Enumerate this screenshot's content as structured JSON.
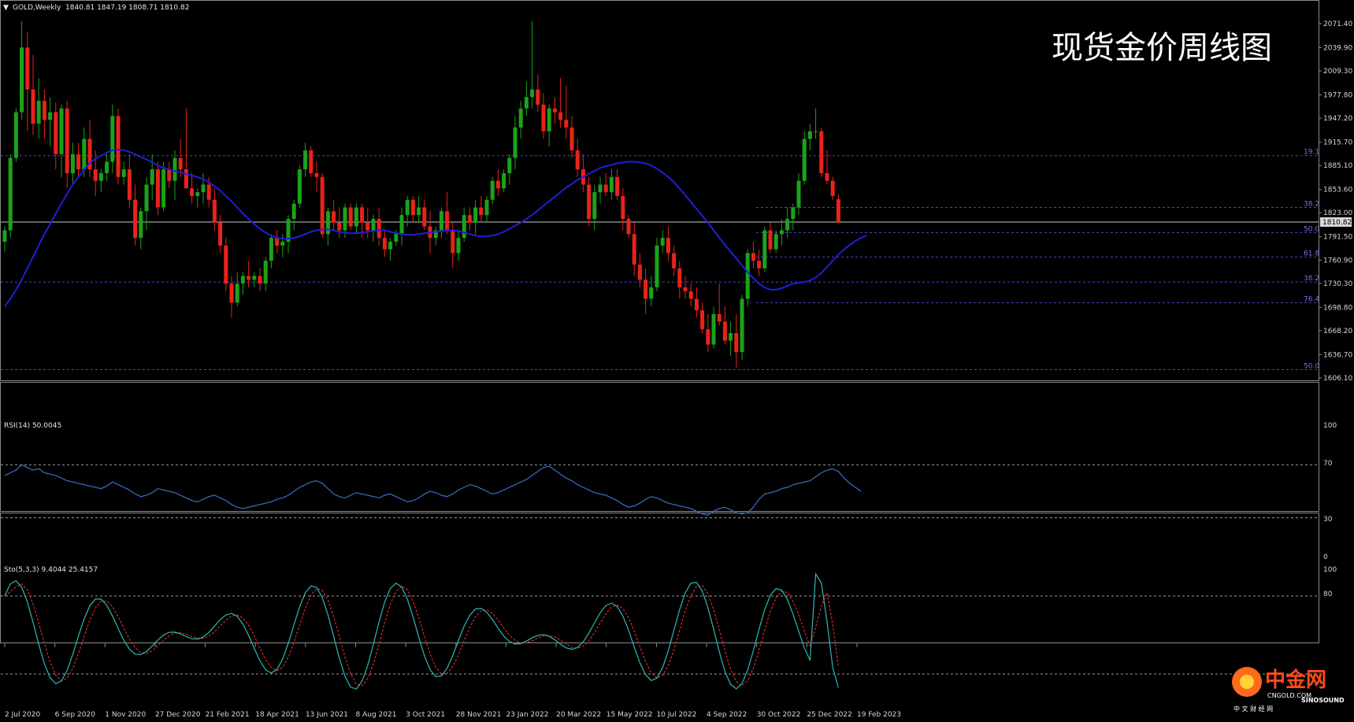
{
  "header": {
    "symbol": "GOLD,Weekly",
    "ohlc": "1840.81 1847.19 1808.71 1810.82",
    "overlay_title": "现货金价周线图"
  },
  "price_labels": [
    "2071.40",
    "2039.90",
    "2009.30",
    "1977.80",
    "1947.20",
    "1915.70",
    "1885.10",
    "1853.60",
    "1823.00",
    "1791.50",
    "1760.90",
    "1730.30",
    "1698.80",
    "1668.20",
    "1636.70",
    "1606.10"
  ],
  "current_price_label": "1810.82",
  "x_labels": [
    "2 Jul 2020",
    "6 Sep 2020",
    "1 Nov 2020",
    "27 Dec 2020",
    "21 Feb 2021",
    "18 Apr 2021",
    "13 Jun 2021",
    "8 Aug 2021",
    "3 Oct 2021",
    "28 Nov 2021",
    "23 Jan 2022",
    "20 Mar 2022",
    "15 May 2022",
    "10 Jul 2022",
    "4 Sep 2022",
    "30 Oct 2022",
    "25 Dec 2022",
    "19 Feb 2023"
  ],
  "fib_labels": [
    "19.1",
    "38.2",
    "50.0",
    "61.8",
    "38.2",
    "76.4",
    "50.0"
  ],
  "rsi": {
    "label": "RSI(14) 50.0045",
    "levels": [
      "100",
      "70",
      "30",
      "0"
    ]
  },
  "stoch": {
    "label": "Sto(5,3,3) 9.4044 25.4157",
    "levels": [
      "100",
      "80"
    ]
  },
  "logo": {
    "brand": "中金网",
    "url": "CNGOLD.COM",
    "slogan": "中 文 财 经 网",
    "partner": "SINOSOUND"
  },
  "colors": {
    "background": "#000000",
    "bull": "#1aa31a",
    "bear": "#e8231a",
    "ma": "#1f1fd6",
    "rsi": "#3a6fc8",
    "stoch_main": "#2fb7b7",
    "stoch_signal": "#d42a2a",
    "grid_dash": "#8888a8",
    "fib": "#4a45c8",
    "price_line": "#c8c8c8"
  },
  "chart_data": {
    "type": "candlestick",
    "title": "现货金价周线图",
    "ylim": [
      1606.1,
      2083.0
    ],
    "current_price": 1810.82,
    "candles": [
      [
        1785,
        1805,
        1772,
        1800
      ],
      [
        1800,
        1900,
        1790,
        1895
      ],
      [
        1895,
        1960,
        1890,
        1955
      ],
      [
        1955,
        2075,
        1945,
        2040
      ],
      [
        2040,
        2060,
        1930,
        1985
      ],
      [
        1985,
        2030,
        1925,
        1940
      ],
      [
        1940,
        2000,
        1920,
        1970
      ],
      [
        1970,
        1985,
        1920,
        1945
      ],
      [
        1945,
        1975,
        1910,
        1955
      ],
      [
        1955,
        1968,
        1880,
        1900
      ],
      [
        1900,
        1965,
        1870,
        1960
      ],
      [
        1960,
        1970,
        1855,
        1875
      ],
      [
        1875,
        1915,
        1860,
        1900
      ],
      [
        1900,
        1915,
        1870,
        1880
      ],
      [
        1880,
        1935,
        1870,
        1920
      ],
      [
        1920,
        1945,
        1870,
        1880
      ],
      [
        1880,
        1905,
        1845,
        1865
      ],
      [
        1865,
        1880,
        1850,
        1875
      ],
      [
        1875,
        1900,
        1865,
        1890
      ],
      [
        1890,
        1965,
        1875,
        1950
      ],
      [
        1950,
        1960,
        1860,
        1870
      ],
      [
        1870,
        1890,
        1860,
        1880
      ],
      [
        1880,
        1900,
        1830,
        1840
      ],
      [
        1840,
        1860,
        1780,
        1790
      ],
      [
        1790,
        1830,
        1775,
        1825
      ],
      [
        1825,
        1870,
        1800,
        1860
      ],
      [
        1860,
        1900,
        1840,
        1880
      ],
      [
        1880,
        1890,
        1820,
        1830
      ],
      [
        1830,
        1890,
        1825,
        1880
      ],
      [
        1880,
        1890,
        1855,
        1865
      ],
      [
        1865,
        1905,
        1840,
        1895
      ],
      [
        1895,
        1920,
        1870,
        1880
      ],
      [
        1880,
        1960,
        1860,
        1855
      ],
      [
        1855,
        1875,
        1835,
        1845
      ],
      [
        1845,
        1855,
        1830,
        1850
      ],
      [
        1850,
        1875,
        1835,
        1860
      ],
      [
        1860,
        1870,
        1830,
        1840
      ],
      [
        1840,
        1855,
        1800,
        1810
      ],
      [
        1810,
        1820,
        1770,
        1780
      ],
      [
        1780,
        1790,
        1720,
        1730
      ],
      [
        1730,
        1740,
        1685,
        1705
      ],
      [
        1705,
        1745,
        1700,
        1730
      ],
      [
        1730,
        1745,
        1715,
        1740
      ],
      [
        1740,
        1760,
        1725,
        1735
      ],
      [
        1735,
        1745,
        1725,
        1740
      ],
      [
        1740,
        1750,
        1720,
        1730
      ],
      [
        1730,
        1765,
        1720,
        1760
      ],
      [
        1760,
        1795,
        1750,
        1790
      ],
      [
        1790,
        1800,
        1770,
        1780
      ],
      [
        1780,
        1795,
        1765,
        1785
      ],
      [
        1785,
        1820,
        1770,
        1815
      ],
      [
        1815,
        1840,
        1800,
        1835
      ],
      [
        1835,
        1885,
        1830,
        1880
      ],
      [
        1880,
        1915,
        1870,
        1905
      ],
      [
        1905,
        1910,
        1870,
        1875
      ],
      [
        1875,
        1890,
        1850,
        1870
      ],
      [
        1870,
        1875,
        1790,
        1795
      ],
      [
        1795,
        1830,
        1780,
        1825
      ],
      [
        1825,
        1840,
        1800,
        1810
      ],
      [
        1810,
        1830,
        1790,
        1800
      ],
      [
        1800,
        1835,
        1790,
        1830
      ],
      [
        1830,
        1835,
        1800,
        1805
      ],
      [
        1805,
        1835,
        1795,
        1830
      ],
      [
        1830,
        1835,
        1790,
        1810
      ],
      [
        1810,
        1830,
        1790,
        1800
      ],
      [
        1800,
        1820,
        1785,
        1815
      ],
      [
        1815,
        1830,
        1780,
        1790
      ],
      [
        1790,
        1800,
        1765,
        1775
      ],
      [
        1775,
        1790,
        1760,
        1785
      ],
      [
        1785,
        1800,
        1780,
        1795
      ],
      [
        1795,
        1830,
        1780,
        1820
      ],
      [
        1820,
        1845,
        1805,
        1840
      ],
      [
        1840,
        1845,
        1810,
        1820
      ],
      [
        1820,
        1845,
        1810,
        1830
      ],
      [
        1830,
        1840,
        1800,
        1805
      ],
      [
        1805,
        1825,
        1770,
        1790
      ],
      [
        1790,
        1805,
        1780,
        1800
      ],
      [
        1800,
        1830,
        1790,
        1825
      ],
      [
        1825,
        1850,
        1795,
        1800
      ],
      [
        1800,
        1810,
        1750,
        1770
      ],
      [
        1770,
        1800,
        1760,
        1790
      ],
      [
        1790,
        1830,
        1785,
        1820
      ],
      [
        1820,
        1830,
        1800,
        1810
      ],
      [
        1810,
        1840,
        1795,
        1830
      ],
      [
        1830,
        1845,
        1810,
        1820
      ],
      [
        1820,
        1845,
        1810,
        1840
      ],
      [
        1840,
        1870,
        1835,
        1865
      ],
      [
        1865,
        1880,
        1845,
        1855
      ],
      [
        1855,
        1880,
        1850,
        1875
      ],
      [
        1875,
        1900,
        1860,
        1895
      ],
      [
        1895,
        1950,
        1880,
        1935
      ],
      [
        1935,
        1970,
        1920,
        1960
      ],
      [
        1960,
        1995,
        1950,
        1975
      ],
      [
        1975,
        2075,
        1960,
        1985
      ],
      [
        1985,
        2005,
        1955,
        1965
      ],
      [
        1965,
        1980,
        1920,
        1930
      ],
      [
        1930,
        1965,
        1910,
        1960
      ],
      [
        1960,
        1975,
        1940,
        1955
      ],
      [
        1955,
        2000,
        1935,
        1945
      ],
      [
        1945,
        1990,
        1920,
        1935
      ],
      [
        1935,
        1950,
        1895,
        1905
      ],
      [
        1905,
        1920,
        1870,
        1880
      ],
      [
        1880,
        1900,
        1850,
        1860
      ],
      [
        1860,
        1870,
        1805,
        1815
      ],
      [
        1815,
        1860,
        1800,
        1850
      ],
      [
        1850,
        1870,
        1835,
        1860
      ],
      [
        1860,
        1875,
        1845,
        1850
      ],
      [
        1850,
        1880,
        1840,
        1870
      ],
      [
        1870,
        1880,
        1840,
        1845
      ],
      [
        1845,
        1855,
        1800,
        1815
      ],
      [
        1815,
        1820,
        1790,
        1795
      ],
      [
        1795,
        1810,
        1740,
        1755
      ],
      [
        1755,
        1770,
        1725,
        1735
      ],
      [
        1735,
        1750,
        1690,
        1710
      ],
      [
        1710,
        1740,
        1700,
        1725
      ],
      [
        1725,
        1790,
        1720,
        1780
      ],
      [
        1780,
        1800,
        1770,
        1790
      ],
      [
        1790,
        1805,
        1760,
        1770
      ],
      [
        1770,
        1780,
        1740,
        1750
      ],
      [
        1750,
        1760,
        1710,
        1725
      ],
      [
        1725,
        1740,
        1710,
        1720
      ],
      [
        1720,
        1730,
        1700,
        1710
      ],
      [
        1710,
        1725,
        1685,
        1695
      ],
      [
        1695,
        1705,
        1665,
        1670
      ],
      [
        1670,
        1690,
        1640,
        1650
      ],
      [
        1650,
        1700,
        1645,
        1690
      ],
      [
        1690,
        1730,
        1675,
        1680
      ],
      [
        1680,
        1700,
        1650,
        1655
      ],
      [
        1655,
        1680,
        1635,
        1665
      ],
      [
        1665,
        1690,
        1620,
        1640
      ],
      [
        1640,
        1715,
        1630,
        1710
      ],
      [
        1710,
        1775,
        1700,
        1770
      ],
      [
        1770,
        1785,
        1750,
        1760
      ],
      [
        1760,
        1775,
        1740,
        1750
      ],
      [
        1750,
        1805,
        1745,
        1800
      ],
      [
        1800,
        1810,
        1770,
        1775
      ],
      [
        1775,
        1800,
        1770,
        1795
      ],
      [
        1795,
        1815,
        1780,
        1800
      ],
      [
        1800,
        1830,
        1790,
        1815
      ],
      [
        1815,
        1835,
        1800,
        1830
      ],
      [
        1830,
        1875,
        1820,
        1865
      ],
      [
        1865,
        1930,
        1860,
        1920
      ],
      [
        1920,
        1940,
        1905,
        1930
      ],
      [
        1930,
        1960,
        1920,
        1930
      ],
      [
        1930,
        1935,
        1870,
        1875
      ],
      [
        1875,
        1905,
        1860,
        1865
      ],
      [
        1865,
        1870,
        1840,
        1845
      ],
      [
        1840.81,
        1847.19,
        1808.71,
        1810.82
      ]
    ],
    "ma": [
      1700,
      1710,
      1722,
      1735,
      1750,
      1765,
      1780,
      1795,
      1808,
      1822,
      1835,
      1848,
      1860,
      1870,
      1880,
      1888,
      1894,
      1898,
      1902,
      1905,
      1906,
      1905,
      1903,
      1900,
      1896,
      1893,
      1889,
      1885,
      1882,
      1880,
      1878,
      1876,
      1874,
      1872,
      1870,
      1867,
      1863,
      1858,
      1852,
      1845,
      1838,
      1830,
      1822,
      1815,
      1808,
      1802,
      1797,
      1793,
      1790,
      1789,
      1789,
      1790,
      1792,
      1795,
      1798,
      1800,
      1801,
      1801,
      1800,
      1798,
      1797,
      1796,
      1796,
      1797,
      1798,
      1799,
      1800,
      1800,
      1798,
      1796,
      1795,
      1794,
      1794,
      1795,
      1796,
      1797,
      1798,
      1799,
      1800,
      1800,
      1799,
      1797,
      1795,
      1793,
      1792,
      1792,
      1793,
      1795,
      1798,
      1802,
      1806,
      1810,
      1815,
      1820,
      1826,
      1832,
      1838,
      1844,
      1850,
      1856,
      1861,
      1866,
      1870,
      1874,
      1878,
      1882,
      1884,
      1886,
      1888,
      1889,
      1890,
      1890,
      1889,
      1888,
      1885,
      1881,
      1876,
      1870,
      1863,
      1855,
      1846,
      1837,
      1828,
      1819,
      1810,
      1800,
      1790,
      1781,
      1772,
      1763,
      1754,
      1745,
      1737,
      1730,
      1725,
      1722,
      1722,
      1724,
      1727,
      1730,
      1731,
      1732,
      1734,
      1738,
      1744,
      1752,
      1760,
      1768,
      1775,
      1781,
      1786,
      1790,
      1793
    ],
    "fib_levels": [
      {
        "label": "19.1",
        "value": 1898
      },
      {
        "label": "38.2",
        "value": 1830
      },
      {
        "label": "50.0",
        "value": 1797
      },
      {
        "label": "61.8",
        "value": 1765
      },
      {
        "label": "38.2",
        "value": 1732
      },
      {
        "label": "76.4",
        "value": 1705
      },
      {
        "label": "50.0",
        "value": 1617
      }
    ],
    "rsi": [
      62,
      64,
      66,
      70,
      68,
      66,
      67,
      64,
      63,
      62,
      60,
      58,
      57,
      56,
      55,
      54,
      53,
      52,
      54,
      57,
      55,
      53,
      51,
      48,
      46,
      47,
      49,
      52,
      51,
      50,
      49,
      47,
      45,
      43,
      42,
      44,
      46,
      47,
      45,
      43,
      40,
      38,
      37,
      38,
      39,
      40,
      41,
      42,
      44,
      45,
      47,
      50,
      53,
      55,
      57,
      58,
      56,
      52,
      48,
      46,
      45,
      47,
      49,
      48,
      47,
      46,
      45,
      47,
      48,
      46,
      44,
      42,
      43,
      45,
      48,
      50,
      49,
      47,
      46,
      48,
      51,
      53,
      55,
      54,
      52,
      50,
      48,
      49,
      51,
      53,
      55,
      57,
      59,
      62,
      65,
      68,
      69,
      66,
      63,
      60,
      58,
      55,
      53,
      51,
      49,
      48,
      47,
      45,
      43,
      40,
      38,
      39,
      41,
      44,
      46,
      45,
      43,
      41,
      40,
      39,
      38,
      37,
      35,
      33,
      32,
      35,
      37,
      38,
      36,
      34,
      33,
      34,
      38,
      44,
      48,
      49,
      50,
      52,
      53,
      55,
      56,
      57,
      58,
      61,
      64,
      66,
      67,
      65,
      60,
      56,
      53,
      50
    ]
  }
}
